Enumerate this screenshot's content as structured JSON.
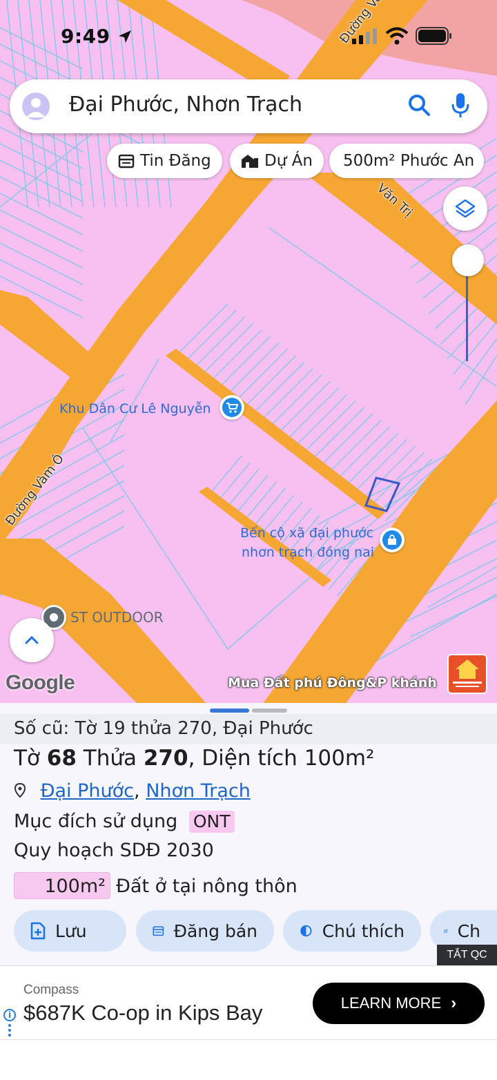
{
  "status": {
    "time": "9:49"
  },
  "search": {
    "query": "Đại Phước, Nhơn Trạch"
  },
  "chips": [
    {
      "label": "Tin Đăng",
      "icon": "listing-icon"
    },
    {
      "label": "Dự Án",
      "icon": "buildings-icon"
    },
    {
      "label": "500m² Phước An",
      "icon": ""
    }
  ],
  "map": {
    "places": {
      "residential": "Khu Dân Cư Lê Nguyễn",
      "ferry_line1": "Bến cộ xã đại phước",
      "ferry_line2": "nhơn trạch đồng nai",
      "outdoor": "ST OUTDOOR"
    },
    "roads": {
      "vam_o_top": "Đường Vàm Ô",
      "van_tri": "Văn Trị",
      "vam_o_left": "Đường Vàm Ô"
    },
    "google_logo": "Google",
    "watermark": "Mua Đất phú Đông&P khánh",
    "colors": {
      "residential_land": "#f7c0f0",
      "road": "#f6a733",
      "orchard": "#f2a4a4",
      "parcel_line": "#7ec8e8"
    }
  },
  "parcel": {
    "old_ref": "Số cũ: Tờ 19 thửa 270, Đại Phước",
    "sheet_label": "Tờ",
    "sheet_no": "68",
    "lot_label": "Thửa",
    "lot_no": "270",
    "area_label": "Diện tích",
    "area": "100m²",
    "ward": "Đại Phước",
    "district": "Nhơn Trạch",
    "purpose_label": "Mục đích sử dụng",
    "purpose_code": "ONT",
    "plan_label": "Quy hoạch SDĐ 2030",
    "plan_area": "100m²",
    "plan_use": "Đất ở tại nông thôn"
  },
  "actions": [
    {
      "label": "Lưu"
    },
    {
      "label": "Đăng bán"
    },
    {
      "label": "Chú thích"
    },
    {
      "label": "Ch"
    }
  ],
  "ad": {
    "tag": "TẮT QC",
    "brand": "Compass",
    "title": "$687K Co-op in Kips Bay",
    "cta": "LEARN MORE"
  }
}
